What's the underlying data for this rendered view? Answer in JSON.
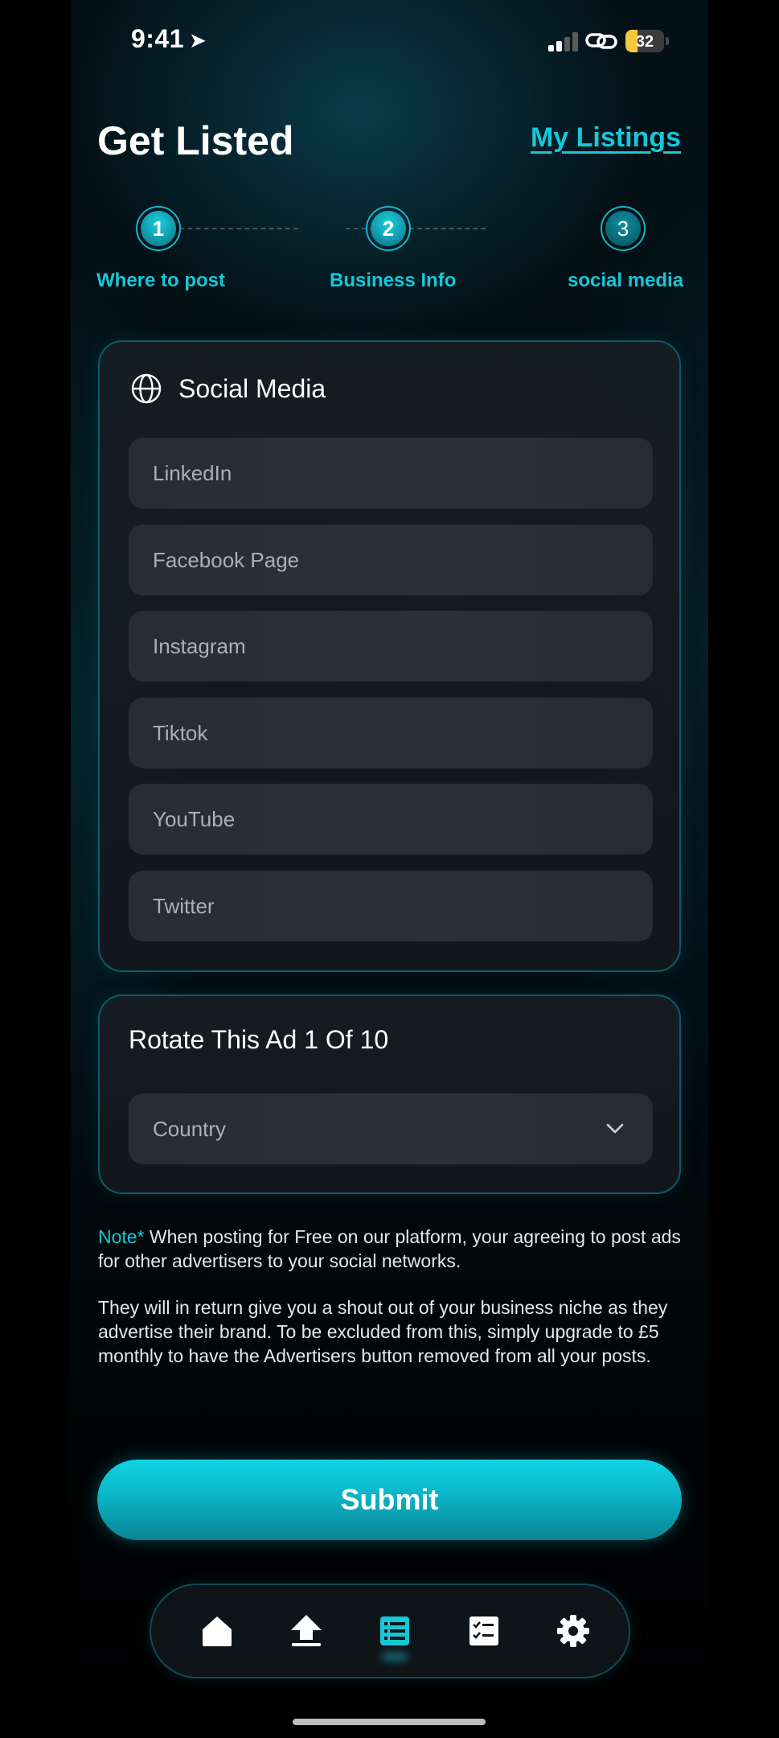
{
  "status_bar": {
    "time": "9:41",
    "battery": "32",
    "battery_level": 0.32,
    "location_icon": "location-arrow-icon",
    "link_icon": "link-icon"
  },
  "header": {
    "title": "Get Listed",
    "my_listings": "My Listings"
  },
  "stepper": {
    "steps": [
      {
        "number": "1",
        "label": "Where to post"
      },
      {
        "number": "2",
        "label": "Business Info"
      },
      {
        "number": "3",
        "label": "social media"
      }
    ]
  },
  "social_card": {
    "icon": "globe-icon",
    "title": "Social Media",
    "fields": [
      {
        "placeholder": "LinkedIn"
      },
      {
        "placeholder": "Facebook Page"
      },
      {
        "placeholder": "Instagram"
      },
      {
        "placeholder": "Tiktok"
      },
      {
        "placeholder": "YouTube"
      },
      {
        "placeholder": "Twitter"
      }
    ]
  },
  "rotate_card": {
    "title": "Rotate This Ad 1 Of 10",
    "country_placeholder": "Country"
  },
  "note": {
    "prefix": "Note*",
    "line1": " When posting for Free on our platform, your agreeing to post ads for other advertisers to your social networks.",
    "line2": "They will in return give you a shout out of your business niche as they advertise their brand. To be excluded from this, simply upgrade to £5 monthly to have the Advertisers button removed from all your posts."
  },
  "submit_label": "Submit",
  "nav": {
    "items": [
      {
        "icon": "home-icon"
      },
      {
        "icon": "upload-icon"
      },
      {
        "icon": "list-icon",
        "active": true
      },
      {
        "icon": "checklist-icon"
      },
      {
        "icon": "settings-icon"
      }
    ]
  },
  "colors": {
    "accent": "#14c8d8",
    "background": "#020a0e",
    "field": "#2a3138",
    "card_border": "#0d5a66",
    "battery": "#f5c93a"
  }
}
